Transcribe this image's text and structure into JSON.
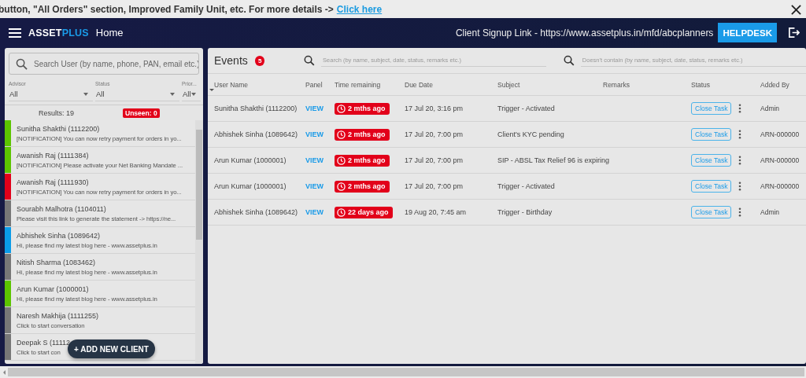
{
  "banner": {
    "text": "button, \"All Orders\" section, Improved Family Unit, etc. For more details ->",
    "link": "Click here"
  },
  "header": {
    "logo_first": "ASSET",
    "logo_second": "PLUS",
    "title": "Home",
    "signup": "Client Signup Link - https://www.assetplus.in/mfd/abcplanners",
    "helpdesk": "HELPDESK"
  },
  "clients_panel": {
    "search": {
      "placeholder": "Search User (by name, phone, PAN, email etc.)"
    },
    "filters": [
      {
        "label": "Advisor",
        "value": "All"
      },
      {
        "label": "Status",
        "value": "All"
      },
      {
        "label": "Prior...",
        "value": "All"
      }
    ],
    "results": "Results: 19",
    "unseen": "Unseen: 0",
    "clients": [
      {
        "name": "Sunitha Shakthi (1112200)",
        "message": "[NOTIFICATION] You can now retry payment for orders in yo...",
        "color": "#5cc400"
      },
      {
        "name": "Awanish Raj (1111384)",
        "message": "[NOTIFICATION] Please activate your Net Banking Mandate ...",
        "color": "#5cc400"
      },
      {
        "name": "Awanish Raj (1111930)",
        "message": "[NOTIFICATION] You can now retry payment for orders in yo...",
        "color": "#e2001a"
      },
      {
        "name": "Sourabh Malhotra (1104011)",
        "message": "Please visit this link to generate the statement -> https://ne...",
        "color": "#777777"
      },
      {
        "name": "Abhishek Sinha (1089642)",
        "message": "Hi, please find my latest blog here - www.assetplus.in",
        "color": "#0a9be8"
      },
      {
        "name": "Nitish Sharma (1083462)",
        "message": "Hi, please find my latest blog here - www.assetplus.in",
        "color": "#777777"
      },
      {
        "name": "Arun Kumar (1000001)",
        "message": "Hi, please find my latest blog here - www.assetplus.in",
        "color": "#5cc400"
      },
      {
        "name": "Naresh Makhija (1111255)",
        "message": "Click to start conversation",
        "color": "#777777"
      },
      {
        "name": "Deepak S (11112",
        "message": "Click to start con",
        "color": "#777777"
      }
    ],
    "add_button": "+ ADD NEW CLIENT"
  },
  "events": {
    "title": "Events",
    "count": "5",
    "search": {
      "placeholder": "Search (by name, subject, date, status, remarks etc.)"
    },
    "exclude": {
      "placeholder": "Doesn't contain (by name, subject, date, status, remarks etc.)"
    },
    "columns": [
      "User Name",
      "Panel",
      "Time remaining",
      "Due Date",
      "Subject",
      "Remarks",
      "Status",
      "Added By"
    ],
    "rows": [
      {
        "user": "Sunitha Shakthi (1112200)",
        "panel": "VIEW",
        "time": "2 mths ago",
        "due": "17 Jul 20, 3:16 pm",
        "subject": "Trigger - Activated",
        "status": "Close Task",
        "added_by": "Admin"
      },
      {
        "user": "Abhishek Sinha (1089642)",
        "panel": "VIEW",
        "time": "2 mths ago",
        "due": "17 Jul 20, 7:00 pm",
        "subject": "Client's KYC pending",
        "status": "Close Task",
        "added_by": "ARN-000000"
      },
      {
        "user": "Arun Kumar (1000001)",
        "panel": "VIEW",
        "time": "2 mths ago",
        "due": "17 Jul 20, 7:00 pm",
        "subject": "SIP - ABSL Tax Relief 96 is expiring",
        "status": "Close Task",
        "added_by": "ARN-000000"
      },
      {
        "user": "Arun Kumar (1000001)",
        "panel": "VIEW",
        "time": "2 mths ago",
        "due": "17 Jul 20, 7:00 pm",
        "subject": "Trigger - Activated",
        "status": "Close Task",
        "added_by": "ARN-000000"
      },
      {
        "user": "Abhishek Sinha (1089642)",
        "panel": "VIEW",
        "time": "22 days ago",
        "due": "19 Aug 20, 7:45 am",
        "subject": "Trigger - Birthday",
        "status": "Close Task",
        "added_by": "Admin"
      }
    ]
  }
}
